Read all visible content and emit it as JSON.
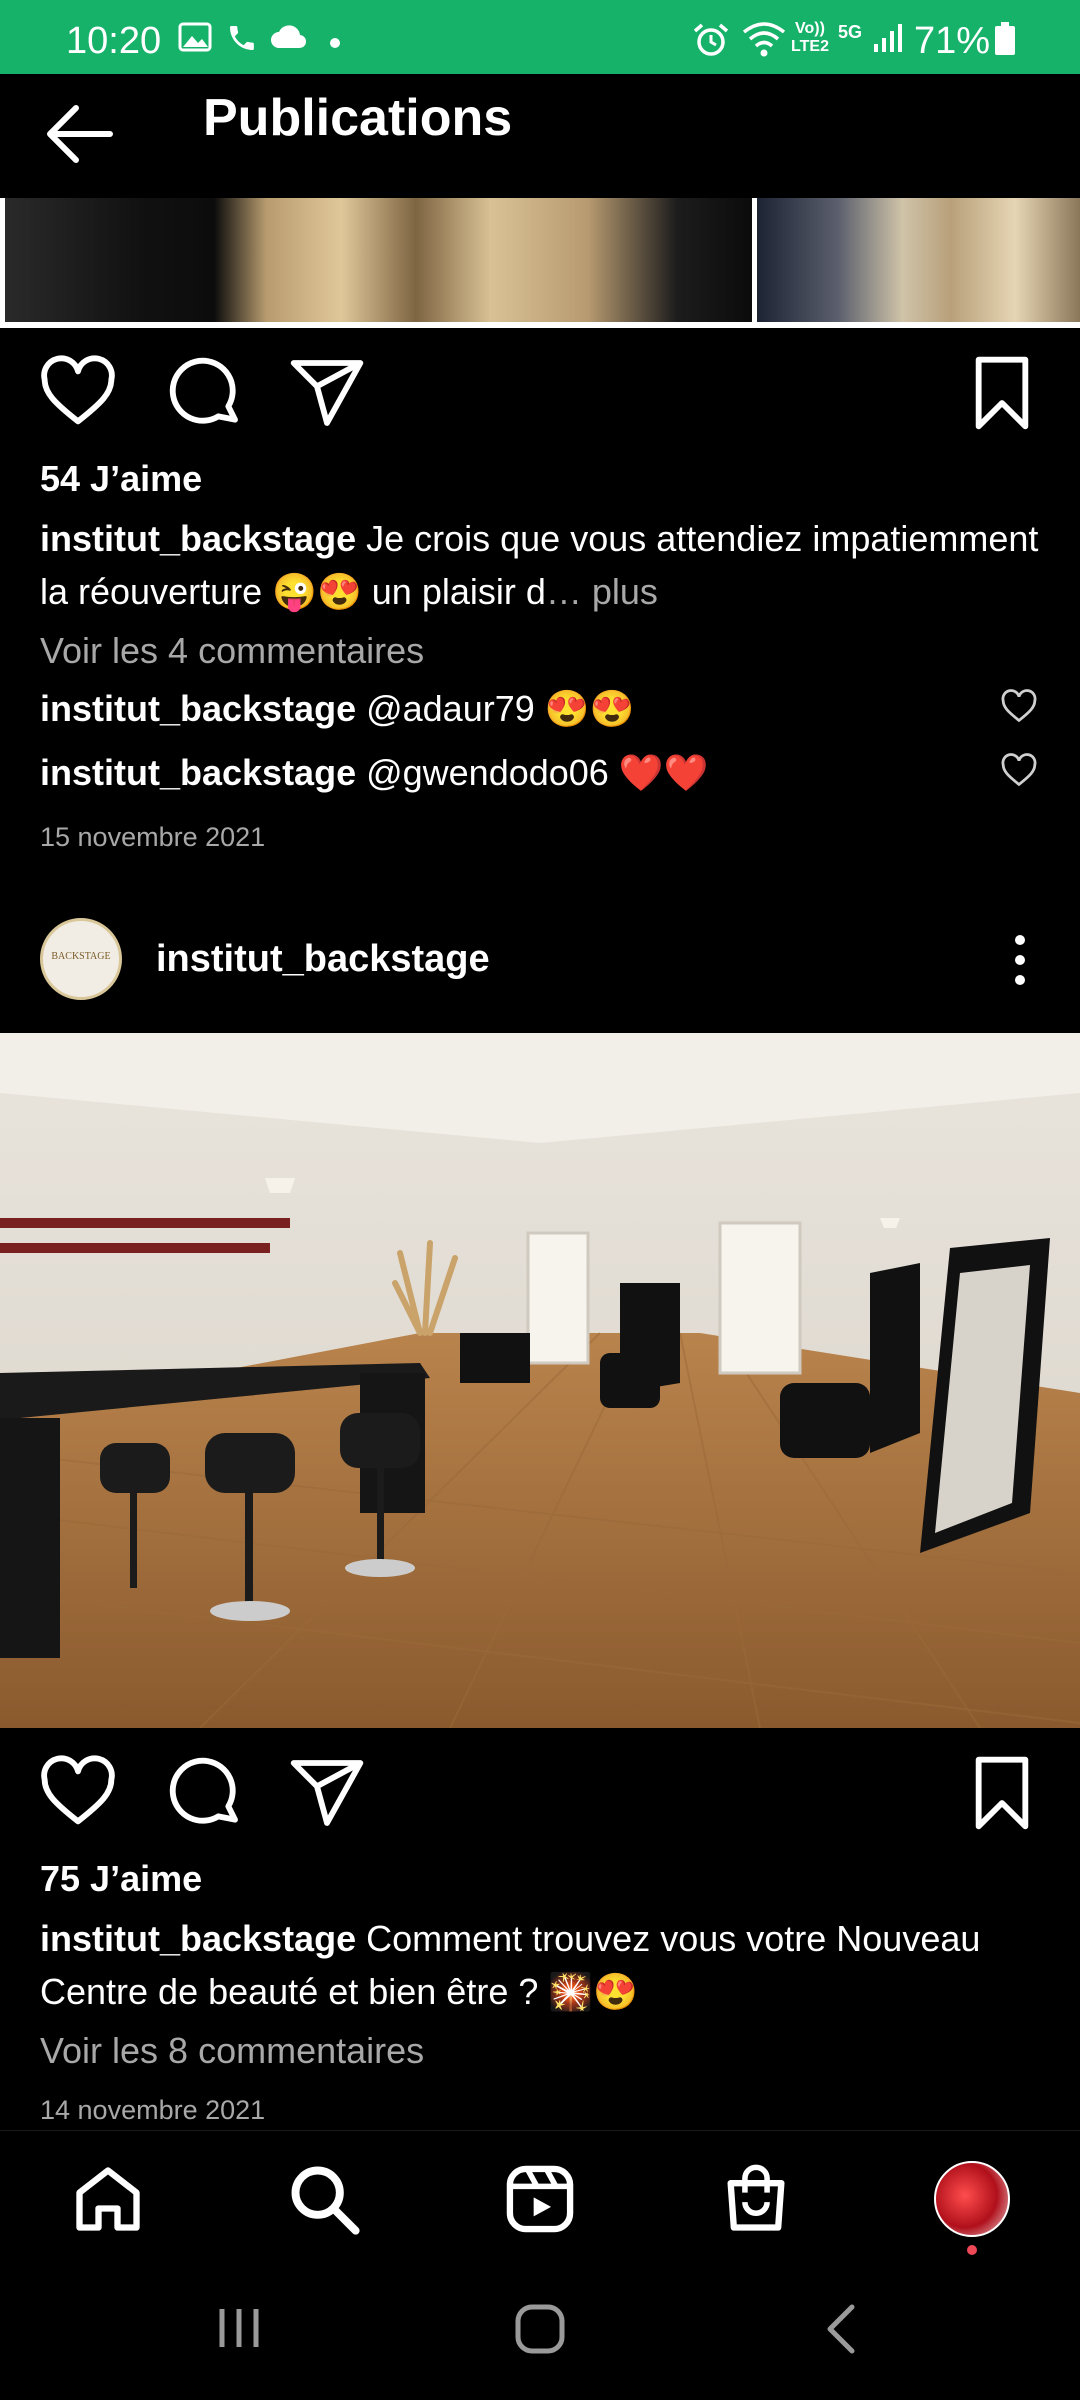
{
  "status": {
    "time": "10:20",
    "battery": "71%",
    "icons": [
      "gallery-icon",
      "phone-icon",
      "cloud-icon",
      "dot-icon",
      "alarm-icon",
      "wifi-icon",
      "volte-icon",
      "5g-icon",
      "signal-icon",
      "battery-icon"
    ],
    "network_label": "Vo)) LTE2",
    "network_gen": "5G"
  },
  "header": {
    "title": "Publications"
  },
  "post1": {
    "likes": "54 J’aime",
    "username": "institut_backstage",
    "caption": " Je crois que vous attendiez impatiemment la réouverture 😜😍 un plaisir d",
    "more_ellipsis": "… ",
    "more_label": "plus",
    "view_comments": "Voir les 4 commentaires",
    "comments": [
      {
        "user": "institut_backstage",
        "text": " @adaur79 😍😍"
      },
      {
        "user": "institut_backstage",
        "text": " @gwendodo06 ❤️❤️"
      }
    ],
    "date": "15 novembre 2021"
  },
  "post2": {
    "username": "institut_backstage",
    "avatar_text": "BACKSTAGE",
    "likes": "75 J’aime",
    "caption_user": "institut_backstage",
    "caption": " Comment trouvez vous votre Nouveau Centre de beauté et bien être ? 🎇😍",
    "view_comments": "Voir les 8 commentaires",
    "date": "14 novembre 2021"
  },
  "nav": {
    "items": [
      "home-icon",
      "search-icon",
      "reels-icon",
      "shop-icon",
      "profile-avatar"
    ],
    "accent": "#ed4956"
  },
  "colors": {
    "statusbar": "#17b26a",
    "muted": "#a8a8a8"
  }
}
